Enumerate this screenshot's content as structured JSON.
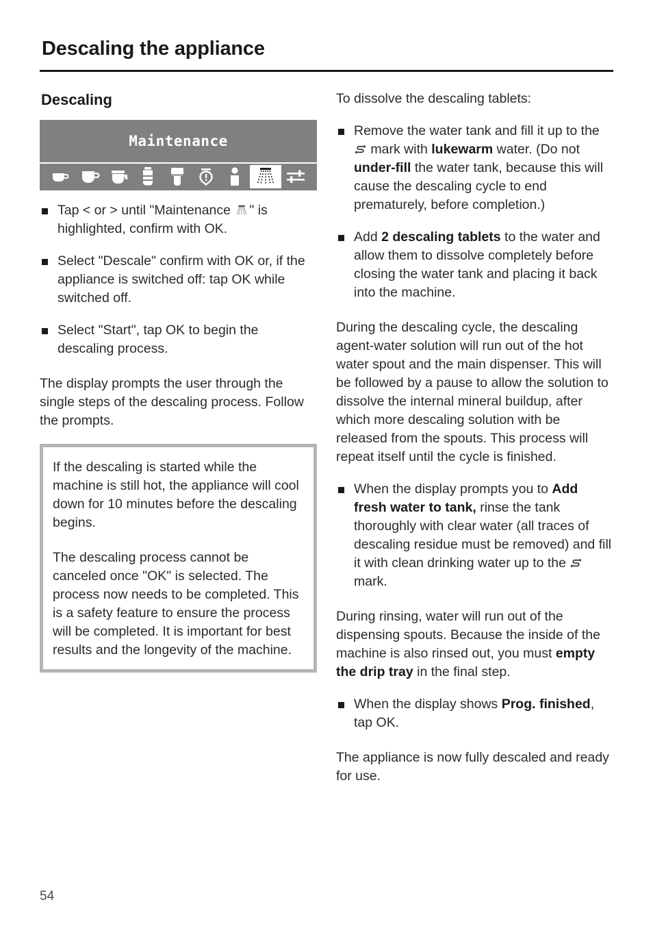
{
  "header": {
    "chapter_title": "Descaling the appliance"
  },
  "left_column": {
    "section_heading": "Descaling",
    "display": {
      "title": "Maintenance",
      "icons": [
        {
          "name": "espresso-cup-icon",
          "selected": false
        },
        {
          "name": "coffee-cup-icon",
          "selected": false
        },
        {
          "name": "coffee-pot-icon",
          "selected": false
        },
        {
          "name": "latte-glass-icon",
          "selected": false
        },
        {
          "name": "milk-container-icon",
          "selected": false
        },
        {
          "name": "timer-icon",
          "selected": false
        },
        {
          "name": "user-profile-icon",
          "selected": false
        },
        {
          "name": "maintenance-spray-icon",
          "selected": true
        },
        {
          "name": "settings-sliders-icon",
          "selected": false
        }
      ],
      "background_color": "#808080",
      "highlight_color": "#ffffff"
    },
    "bullets": [
      {
        "parts": [
          {
            "t": "Tap < or > until \"Maintenance "
          },
          {
            "glyph": "maintenance-spray-icon"
          },
          {
            "t": "\" is highlighted, confirm with OK."
          }
        ]
      },
      {
        "parts": [
          {
            "t": "Select \"Descale\" confirm with OK or, if the appliance is switched off: tap OK while switched off."
          }
        ]
      },
      {
        "parts": [
          {
            "t": "Select \"Start\", tap OK to begin the descaling process."
          }
        ]
      }
    ],
    "paragraph": "The display prompts the user through the single steps of the descaling process. Follow the prompts.",
    "note_box": {
      "border_color": "#b5b5b5",
      "paragraphs": [
        "If the descaling is started while the machine is still hot, the appliance will cool down for 10 minutes before the descaling begins.",
        "The descaling process cannot be canceled once \"OK\" is selected. The process now needs to be completed. This is a safety feature to ensure the process will be completed. It is important for best results and the longevity of the machine."
      ]
    }
  },
  "right_column": {
    "intro": "To dissolve the descaling tablets:",
    "bullets_top": [
      {
        "parts": [
          {
            "t": "Remove the water tank and fill it up to the "
          },
          {
            "glyph": "water-level-mark-icon"
          },
          {
            "t": " mark with "
          },
          {
            "b": "lukewarm"
          },
          {
            "t": " water. (Do not "
          },
          {
            "b": "under-fill"
          },
          {
            "t": " the water tank, because this will cause the descaling cycle to end prematurely, before completion.)"
          }
        ]
      },
      {
        "parts": [
          {
            "t": "Add "
          },
          {
            "b": "2 descaling tablets"
          },
          {
            "t": " to the water and allow them to dissolve completely before closing the water tank and placing it back into the machine."
          }
        ]
      }
    ],
    "paragraph_cycle": "During the descaling cycle, the descaling agent-water solution will run out of the hot water spout and the main dispenser. This will be followed by a pause to allow the solution to dissolve the internal mineral buildup, after which more descaling solution with be released from the spouts. This process will repeat itself until the cycle is finished.",
    "bullet_fresh_water": {
      "parts": [
        {
          "t": "When the display prompts you to "
        },
        {
          "b": "Add fresh water to tank,"
        },
        {
          "t": " rinse the tank thoroughly with clear water (all traces of descaling residue must be removed) and fill it with clean drinking water up to the "
        },
        {
          "glyph": "water-level-mark-icon"
        },
        {
          "t": " mark."
        }
      ]
    },
    "paragraph_rinsing": {
      "parts": [
        {
          "t": "During rinsing, water will run out of the dispensing spouts. Because the inside of the machine is also rinsed out, you must "
        },
        {
          "b": "empty the drip tray"
        },
        {
          "t": " in the final step."
        }
      ]
    },
    "bullet_prog_finished": {
      "parts": [
        {
          "t": "When the display shows "
        },
        {
          "b": "Prog. finished"
        },
        {
          "t": ", tap OK."
        }
      ]
    },
    "paragraph_final": "The appliance is now fully descaled and ready for use."
  },
  "footer": {
    "page_number": "54"
  }
}
